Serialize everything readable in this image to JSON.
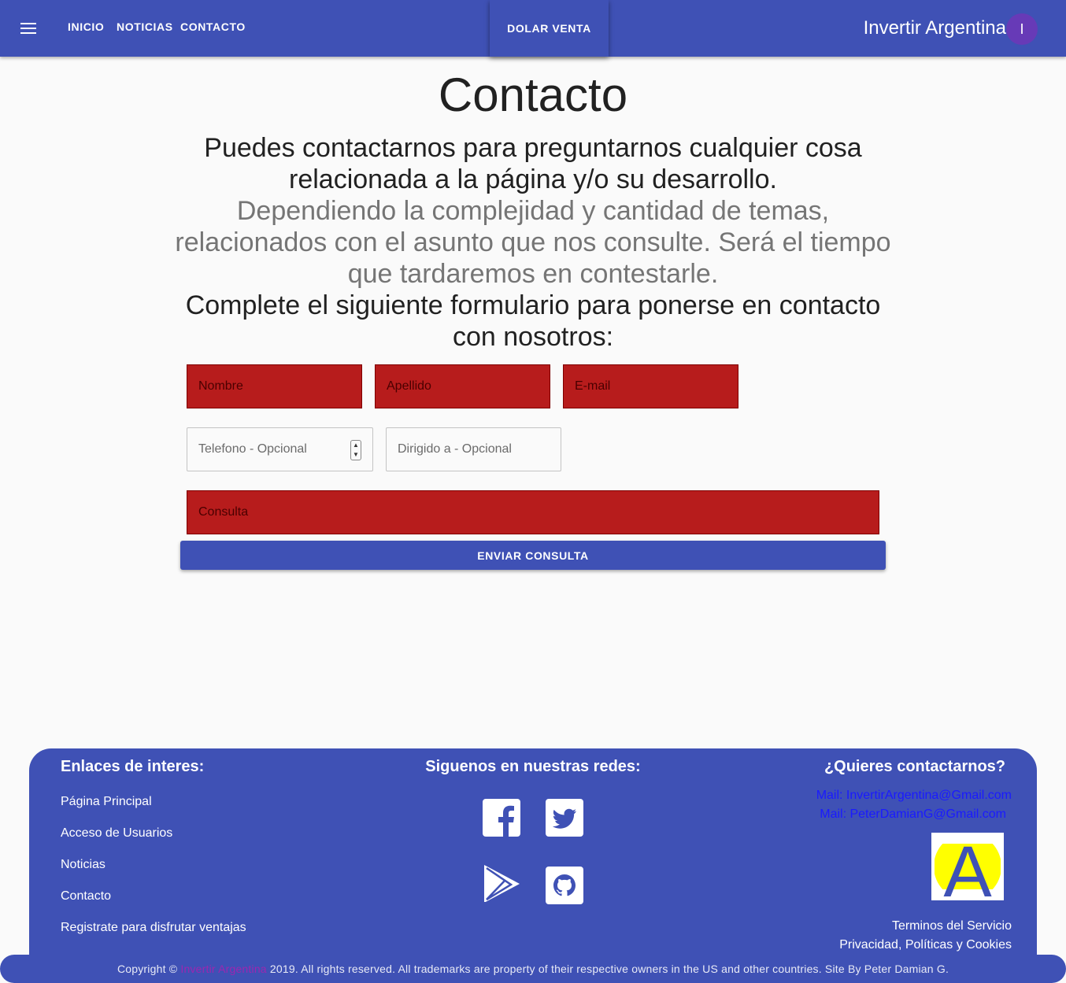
{
  "header": {
    "nav": [
      "INICIO",
      "NOTICIAS",
      "CONTACTO"
    ],
    "dolar_button": "DOLAR VENTA",
    "brand": "Invertir Argentina",
    "avatar_letter": "I"
  },
  "main": {
    "title": "Contacto",
    "intro_line1": "Puedes contactarnos para preguntarnos cualquier cosa relacionada a la página y/o su desarrollo.",
    "intro_line2": "Dependiendo la complejidad y cantidad de temas, relacionados con el asunto que nos consulte. Será el tiempo que tardaremos en contestarle.",
    "intro_line3": "Complete el siguiente formulario para ponerse en contacto con nosotros:"
  },
  "form": {
    "nombre": "Nombre",
    "apellido": "Apellido",
    "email": "E-mail",
    "telefono": "Telefono - Opcional",
    "dirigido": "Dirigido a - Opcional",
    "consulta": "Consulta",
    "submit": "ENVIAR CONSULTA"
  },
  "footer": {
    "links_heading": "Enlaces de interes:",
    "links": [
      "Página Principal",
      "Acceso de Usuarios",
      "Noticias",
      "Contacto",
      "Registrate para disfrutar ventajas"
    ],
    "social_heading": "Siguenos en nuestras redes:",
    "social_icons": [
      "facebook-icon",
      "twitter-icon",
      "google-play-icon",
      "github-icon"
    ],
    "contact_heading": "¿Quieres contactarnos?",
    "mail1": "Mail: InvertirArgentina@Gmail.com",
    "mail2": "Mail: PeterDamianG@Gmail.com",
    "logo_letter": "A",
    "terms": "Terminos del Servicio",
    "privacy": "Privacidad, Políticas y Cookies"
  },
  "copyright": {
    "prefix": "Copyright ©",
    "brand": "Invertir Argentina",
    "suffix": "2019. All rights reserved. All trademarks are property of their respective owners in the US and other countries. Site By Peter Damian G."
  },
  "colors": {
    "primary": "#3f51b5",
    "error": "#b71c1c",
    "avatar": "#673ab7",
    "mail_link": "#1a1aff"
  }
}
